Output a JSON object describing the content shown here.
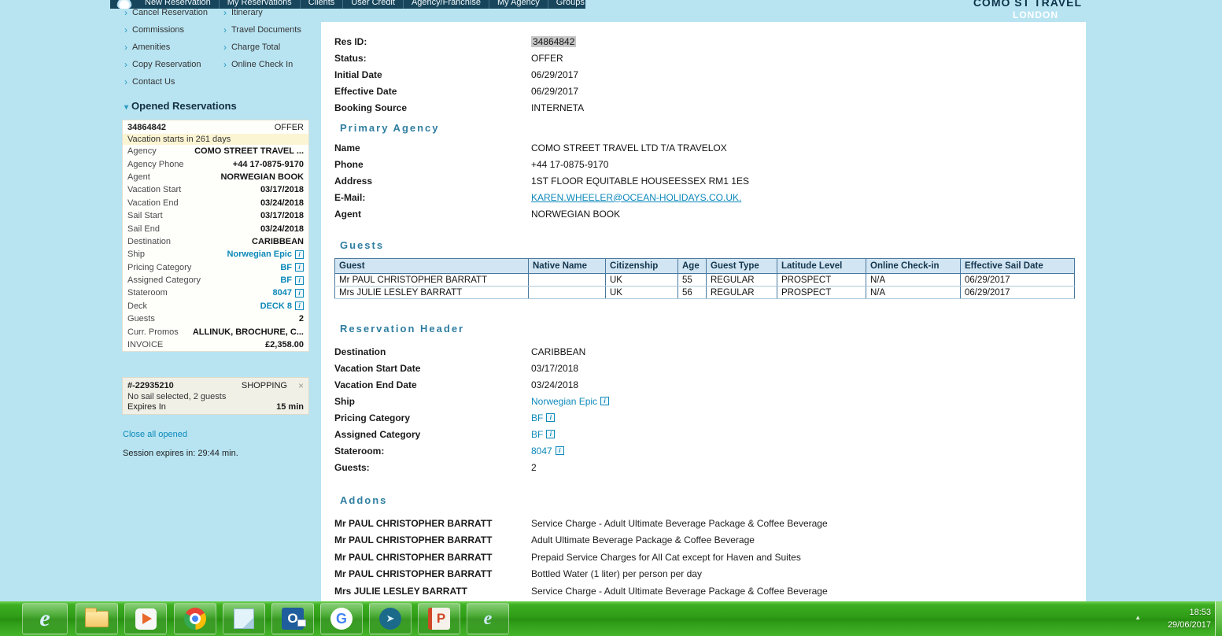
{
  "icons": {
    "chevron": "›",
    "collapse": "▾",
    "close": "×",
    "info": "i",
    "tray_expand": "▲"
  },
  "top_nav": {
    "items": [
      "New Reservation",
      "My Reservations",
      "Clients",
      "User Credit",
      "Agency/Franchise",
      "My Agency",
      "Groups"
    ],
    "agency_text": "COMO ST TRAVEL",
    "location": "LONDON"
  },
  "sidebar": {
    "links_col1": [
      "Cancel Reservation",
      "Commissions",
      "Amenities",
      "Copy Reservation",
      "Contact Us"
    ],
    "links_col2": [
      "Itinerary",
      "Travel Documents",
      "Charge Total",
      "Online Check In"
    ],
    "opened_title": "Opened Reservations",
    "reservation_card": {
      "id": "34864842",
      "status": "OFFER",
      "banner": "Vacation starts in 261 days",
      "rows": [
        {
          "label": "Agency",
          "value": "COMO STREET TRAVEL ..."
        },
        {
          "label": "Agency Phone",
          "value": "+44 17-0875-9170"
        },
        {
          "label": "Agent",
          "value": "NORWEGIAN BOOK"
        },
        {
          "label": "Vacation Start",
          "value": "03/17/2018"
        },
        {
          "label": "Vacation End",
          "value": "03/24/2018"
        },
        {
          "label": "Sail Start",
          "value": "03/17/2018"
        },
        {
          "label": "Sail End",
          "value": "03/24/2018"
        },
        {
          "label": "Destination",
          "value": "CARIBBEAN"
        },
        {
          "label": "Ship",
          "value": "Norwegian Epic",
          "link": true,
          "info": true
        },
        {
          "label": "Pricing Category",
          "value": "BF",
          "link": true,
          "info": true
        },
        {
          "label": "Assigned Category",
          "value": "BF",
          "link": true,
          "info": true
        },
        {
          "label": "Stateroom",
          "value": "8047",
          "link": true,
          "info": true
        },
        {
          "label": "Deck",
          "value": "DECK 8",
          "link": true,
          "info": true
        },
        {
          "label": "Guests",
          "value": "2"
        },
        {
          "label": "Curr. Promos",
          "value": "ALLINUK, BROCHURE, C..."
        },
        {
          "label": "INVOICE",
          "value": "£2,358.00"
        }
      ]
    },
    "shopping_card": {
      "id": "#-22935210",
      "status": "SHOPPING",
      "note": "No sail selected, 2 guests",
      "expires_label": "Expires In",
      "expires_value": "15 min"
    },
    "close_all": "Close all opened",
    "session": "Session expires in: 29:44 min."
  },
  "main": {
    "overview_fields": [
      {
        "label": "Res ID:",
        "value": "34864842",
        "highlight": true
      },
      {
        "label": "Status:",
        "value": "OFFER"
      },
      {
        "label": "Initial Date",
        "value": "06/29/2017"
      },
      {
        "label": "Effective Date",
        "value": "06/29/2017"
      },
      {
        "label": "Booking Source",
        "value": "INTERNETA"
      }
    ],
    "primary_agency": {
      "title": "Primary Agency",
      "fields": [
        {
          "label": "Name",
          "value": "COMO STREET TRAVEL LTD T/A TRAVELOX"
        },
        {
          "label": "Phone",
          "value": "+44 17-0875-9170"
        },
        {
          "label": "Address",
          "value": "1ST FLOOR EQUITABLE HOUSEESSEX RM1 1ES"
        },
        {
          "label": "E-Mail:",
          "value": "KAREN.WHEELER@OCEAN-HOLIDAYS.CO.UK.",
          "link": true
        },
        {
          "label": "Agent",
          "value": "NORWEGIAN BOOK"
        }
      ]
    },
    "guests": {
      "title": "Guests",
      "columns": [
        "Guest",
        "Native Name",
        "Citizenship",
        "Age",
        "Guest Type",
        "Latitude Level",
        "Online Check-in",
        "Effective Sail Date"
      ],
      "rows": [
        {
          "guest": "Mr PAUL CHRISTOPHER BARRATT",
          "native": "",
          "citizenship": "UK",
          "age": "55",
          "type": "REGULAR",
          "latitude": "PROSPECT",
          "checkin": "N/A",
          "sail": "06/29/2017"
        },
        {
          "guest": "Mrs JULIE LESLEY BARRATT",
          "native": "",
          "citizenship": "UK",
          "age": "56",
          "type": "REGULAR",
          "latitude": "PROSPECT",
          "checkin": "N/A",
          "sail": "06/29/2017"
        }
      ]
    },
    "reservation_header": {
      "title": "Reservation Header",
      "fields": [
        {
          "label": "Destination",
          "value": "CARIBBEAN"
        },
        {
          "label": "Vacation Start Date",
          "value": "03/17/2018"
        },
        {
          "label": "Vacation End Date",
          "value": "03/24/2018"
        },
        {
          "label": "Ship",
          "value": "Norwegian Epic",
          "link": true,
          "info": true
        },
        {
          "label": "Pricing Category",
          "value": "BF",
          "link": true,
          "info": true
        },
        {
          "label": "Assigned Category",
          "value": "BF",
          "link": true,
          "info": true
        },
        {
          "label": "Stateroom:",
          "value": "8047",
          "link": true,
          "info": true
        },
        {
          "label": "Guests:",
          "value": "2"
        }
      ]
    },
    "addons": {
      "title": "Addons",
      "items": [
        {
          "name": "Mr PAUL CHRISTOPHER BARRATT",
          "desc": "Service Charge - Adult Ultimate Beverage Package & Coffee Beverage"
        },
        {
          "name": "Mr PAUL CHRISTOPHER BARRATT",
          "desc": "Adult Ultimate Beverage Package & Coffee Beverage"
        },
        {
          "name": "Mr PAUL CHRISTOPHER BARRATT",
          "desc": "Prepaid Service Charges for All Cat except for Haven and Suites"
        },
        {
          "name": "Mr PAUL CHRISTOPHER BARRATT",
          "desc": "Bottled Water (1 liter) per person per day"
        },
        {
          "name": "Mrs JULIE LESLEY BARRATT",
          "desc": "Service Charge - Adult Ultimate Beverage Package & Coffee Beverage"
        }
      ]
    }
  },
  "taskbar": {
    "time": "18:53",
    "date": "29/06/2017",
    "glyphs": {
      "ie": "e",
      "outlook": "O",
      "google": "G",
      "powerpoint": "P",
      "arrow": "➤",
      "ie2": "e"
    }
  },
  "colors": {
    "accent_teal": "#0d89ba",
    "nav_bg": "#17465c",
    "taskbar_green": "#3fae24",
    "section_title": "#2f7ea0",
    "highlight_gray": "#c6c6c6",
    "banner_yellow": "#fcf5d4"
  }
}
